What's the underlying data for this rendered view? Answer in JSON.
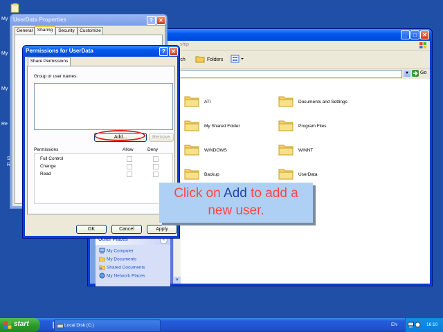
{
  "desktop": {
    "icons": [
      {
        "label": "My"
      },
      {
        "label": "My"
      },
      {
        "label": "My"
      },
      {
        "label": "Re"
      },
      {
        "label": "S"
      },
      {
        "label": "R"
      }
    ]
  },
  "explorer": {
    "partial_address": "ship",
    "toolbar": {
      "search_label": "rch",
      "folders_label": "Folders"
    },
    "go_label": "Go",
    "folders": [
      {
        "name": "ATI"
      },
      {
        "name": "Documents and Settings"
      },
      {
        "name": "My Shared Folder"
      },
      {
        "name": "Program Files"
      },
      {
        "name": "WINDOWS"
      },
      {
        "name": "WINNT"
      },
      {
        "name": "Backup"
      },
      {
        "name": "UserData"
      }
    ],
    "other_places": {
      "title": "Other Places",
      "items": [
        {
          "label": "My Computer"
        },
        {
          "label": "My Documents"
        },
        {
          "label": "Shared Documents"
        },
        {
          "label": "My Network Places"
        }
      ]
    }
  },
  "properties": {
    "title": "UserData Properties",
    "tabs": [
      "General",
      "Sharing",
      "Security",
      "Customize"
    ],
    "help": "?",
    "close": "✕"
  },
  "permissions": {
    "title": "Permissions for UserData",
    "tab": "Share Permissions",
    "group_label": "Group or user names:",
    "add_label": "Add...",
    "remove_label": "Remove",
    "permissions_label": "Permissions",
    "allow_label": "Allow",
    "deny_label": "Deny",
    "rows": [
      {
        "name": "Full Control"
      },
      {
        "name": "Change"
      },
      {
        "name": "Read"
      }
    ],
    "ok_label": "OK",
    "cancel_label": "Cancel",
    "apply_label": "Apply",
    "help": "?",
    "close": "✕"
  },
  "callout": {
    "part1": "Click on ",
    "highlight": "Add",
    "part2": " to add a",
    "line2": "new user."
  },
  "taskbar": {
    "start_label": "start",
    "task_label": "Local Disk (C:)",
    "lang": "EN",
    "time": "16:10"
  },
  "colors": {
    "desktop": "#1f4fa6",
    "callout_bg": "#aed0f5",
    "callout_text": "#ff4444",
    "callout_highlight": "#2244aa",
    "highlight_ring": "#e21b1b"
  }
}
